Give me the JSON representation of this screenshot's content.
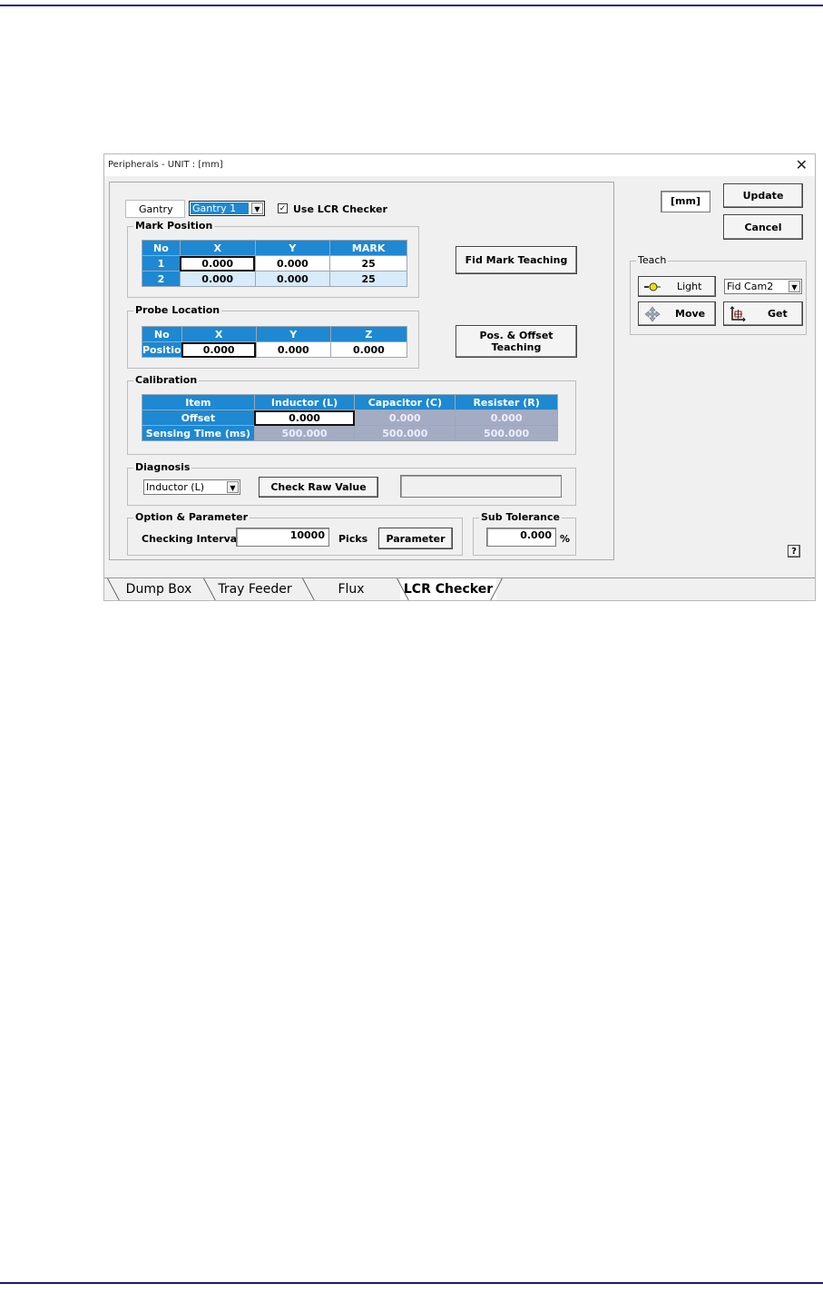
{
  "window": {
    "title": "Peripherals - UNIT : [mm]",
    "close": "✕"
  },
  "gantry": {
    "label": "Gantry",
    "selected": "Gantry 1",
    "use_lcr_label": "Use LCR Checker",
    "use_lcr_checked": true
  },
  "mark_position": {
    "title": "Mark Position",
    "headers": [
      "No",
      "X",
      "Y",
      "MARK"
    ],
    "rows": [
      {
        "no": "1",
        "x": "0.000",
        "y": "0.000",
        "mark": "25"
      },
      {
        "no": "2",
        "x": "0.000",
        "y": "0.000",
        "mark": "25"
      }
    ]
  },
  "probe_location": {
    "title": "Probe Location",
    "headers": [
      "No",
      "X",
      "Y",
      "Z"
    ],
    "row": {
      "no": "Positio",
      "x": "0.000",
      "y": "0.000",
      "z": "0.000"
    }
  },
  "calibration": {
    "title": "Calibration",
    "headers": [
      "Item",
      "Inductor (L)",
      "Capacitor (C)",
      "Resister (R)"
    ],
    "rows": [
      {
        "item": "Offset",
        "l": "0.000",
        "c": "0.000",
        "r": "0.000"
      },
      {
        "item": "Sensing Time (ms)",
        "l": "500.000",
        "c": "500.000",
        "r": "500.000"
      }
    ]
  },
  "diagnosis": {
    "title": "Diagnosis",
    "selected": "Inductor (L)",
    "check_raw": "Check Raw Value",
    "raw_value": ""
  },
  "option": {
    "title": "Option & Parameter",
    "interval_label": "Checking Interval",
    "interval_value": "10000",
    "picks_label": "Picks",
    "parameter_btn": "Parameter"
  },
  "sub_tolerance": {
    "title": "Sub Tolerance",
    "value": "0.000",
    "unit": "%"
  },
  "buttons": {
    "fid_mark": "Fid Mark Teaching",
    "pos_offset": "Pos. & Offset Teaching",
    "update": "Update",
    "cancel": "Cancel",
    "unit_display": "[mm]"
  },
  "teach": {
    "title": "Teach",
    "light": "Light",
    "camera": "Fid Cam2",
    "move": "Move",
    "get": "Get"
  },
  "help": "?",
  "tabs": [
    "Dump Box",
    "Tray Feeder",
    "Flux",
    "LCR Checker"
  ],
  "active_tab": "LCR Checker"
}
